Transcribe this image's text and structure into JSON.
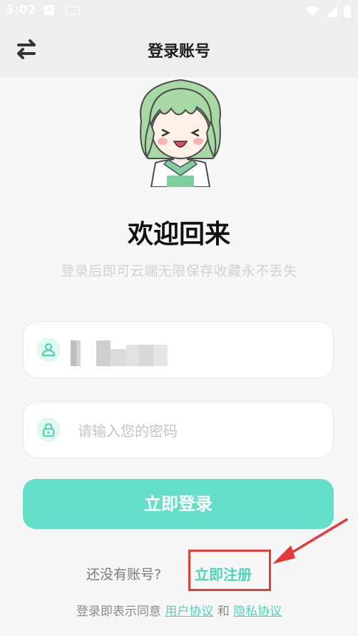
{
  "status_bar": {
    "time": "3:02",
    "notification_icon": "A"
  },
  "header": {
    "title": "登录账号",
    "switch_icon": "swap-arrows-icon"
  },
  "welcome": {
    "title": "欢迎回来",
    "subtitle": "登录后即可云端无限保存收藏永不丢失"
  },
  "form": {
    "account_icon": "user-icon",
    "password_icon": "lock-icon",
    "password_placeholder": "请输入您的密码",
    "login_label": "立即登录"
  },
  "register": {
    "prompt": "还没有账号?",
    "link_label": "立即注册"
  },
  "agreement": {
    "prefix": "登录即表示同意",
    "user_agreement": "用户协议",
    "and": "和",
    "privacy_policy": "隐私协议"
  },
  "colors": {
    "accent": "#66dfca",
    "link": "#4fd3b9",
    "highlight": "#e53a3a"
  }
}
